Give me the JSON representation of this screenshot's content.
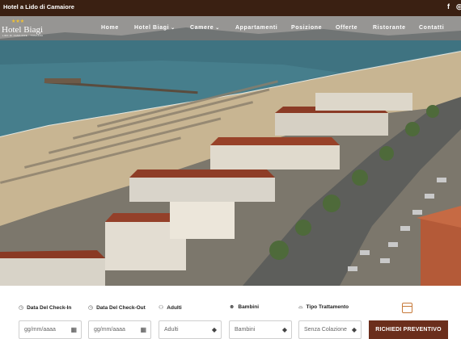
{
  "topbar": {
    "title": "Hotel a Lido di Camaiore",
    "facebook_icon": "f",
    "instagram_icon": "◎"
  },
  "logo": {
    "stars": "★★★",
    "name": "Hotel Biagi",
    "tagline": "LIDO DI CAMAIORE · TOSCANA"
  },
  "nav": {
    "home": "Home",
    "hotel": "Hotel Biagi",
    "camere": "Camere",
    "appartamenti": "Appartamenti",
    "posizione": "Posizione",
    "offerte": "Offerte",
    "ristorante": "Ristorante",
    "contatti": "Contatti",
    "chevron": "⌄"
  },
  "booking": {
    "checkin_label": "Data Del Check-In",
    "checkout_label": "Data Del Check-Out",
    "adulti_label": "Adulti",
    "bambini_label": "Bambini",
    "trattamento_label": "Tipo Trattamento",
    "checkin_placeholder": "gg/mm/aaaa",
    "checkout_placeholder": "gg/mm/aaaa",
    "adulti_value": "Adulti",
    "bambini_value": "Bambini",
    "trattamento_value": "Senza Colazione",
    "submit": "RICHIEDI PREVENTIVO",
    "clock_icon": "◷",
    "people_icon": "⚇",
    "child_icon": "☻",
    "tray_icon": "⌓",
    "calendar_icon": "▦",
    "select_icon": "◆"
  },
  "colors": {
    "topbar": "#3a2012",
    "cta": "#6b2e1c",
    "accent": "#c77a3a"
  }
}
